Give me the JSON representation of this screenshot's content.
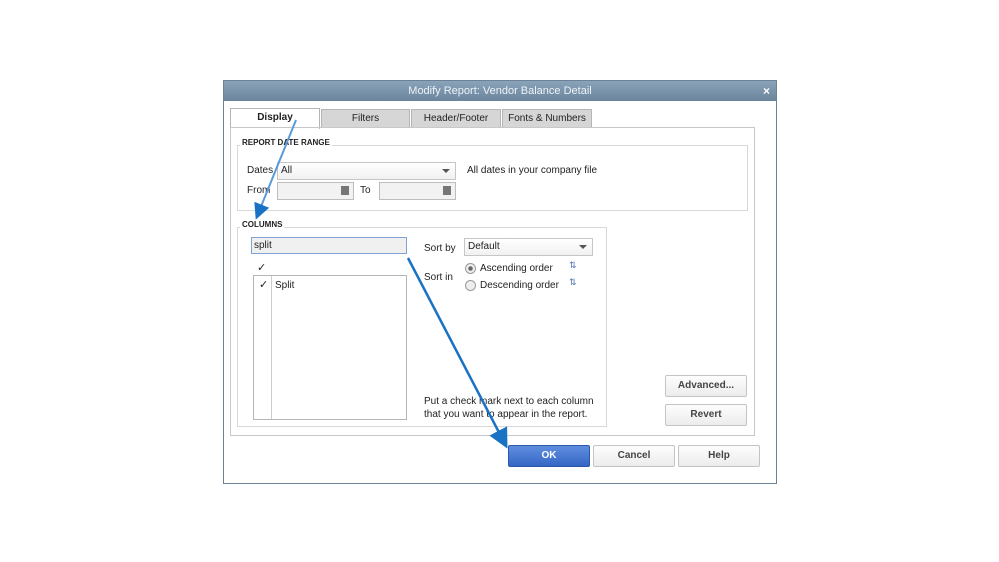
{
  "title": "Modify Report: Vendor Balance Detail",
  "close_glyph": "×",
  "tabs": [
    {
      "label": "Display"
    },
    {
      "label": "Filters"
    },
    {
      "label": "Header/Footer"
    },
    {
      "label": "Fonts & Numbers"
    }
  ],
  "date_range": {
    "heading": "REPORT DATE RANGE",
    "dates_label": "Dates",
    "dates_value": "All",
    "dates_desc": "All dates in your company file",
    "from_label": "From",
    "from_value": "",
    "to_label": "To",
    "to_value": ""
  },
  "columns": {
    "heading": "COLUMNS",
    "search_value": "split",
    "check_header": "✓",
    "list": [
      {
        "checked": "✓",
        "name": "Split"
      }
    ],
    "sort_by_label": "Sort by",
    "sort_by_value": "Default",
    "sort_in_label": "Sort in",
    "ascending": "Ascending order",
    "descending": "Descending order",
    "selected_order": "ascending",
    "hint": "Put a check mark next to each column that you want to appear in the report."
  },
  "buttons": {
    "advanced": "Advanced...",
    "revert": "Revert",
    "ok": "OK",
    "cancel": "Cancel",
    "help": "Help"
  },
  "colors": {
    "accent": "#3a6fc9",
    "annotation_arrow": "#1a72c4",
    "titlebar": "#7891a8"
  }
}
